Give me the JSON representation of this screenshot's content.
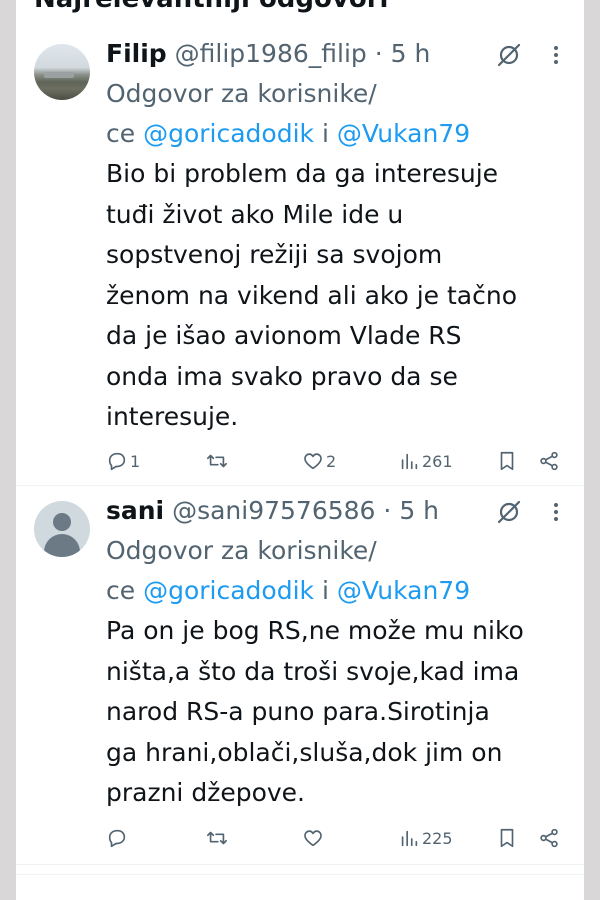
{
  "section": {
    "title": "Najrelevantniji odgovori"
  },
  "tweets": [
    {
      "name": "Filip",
      "handle": "@filip1986_filip",
      "dot": "·",
      "time": "5 h",
      "reply_prefix": "Odgovor za korisnike/",
      "reply_prefix2": "ce ",
      "mention1": "@goricadodik",
      "conj": " i ",
      "mention2": "@Vukan79",
      "body_lines": [
        "Bio bi problem da ga interesuje",
        "tuđi život ako Mile ide u",
        "sopstvenoj režiji sa svojom",
        "ženom na vikend ali ako je tačno",
        "da je išao avionom Vlade RS",
        "onda ima svako pravo da se",
        "interesuje."
      ],
      "replies": "1",
      "retweets": "",
      "likes": "2",
      "views": "261",
      "avatar_icon": "user-photo-avatar"
    },
    {
      "name": "sani",
      "handle": "@sani97576586",
      "dot": "·",
      "time": "5 h",
      "reply_prefix": "Odgovor za korisnike/",
      "reply_prefix2": "ce ",
      "mention1": "@goricadodik",
      "conj": " i ",
      "mention2": "@Vukan79",
      "body_lines": [
        "Pa on je bog RS,ne može mu niko",
        "ništa,a što da troši svoje,kad ima",
        "narod RS-a puno para.Sirotinja",
        "ga hrani,oblači,sluša,dok jim on",
        "prazni džepove."
      ],
      "replies": "",
      "retweets": "",
      "likes": "",
      "views": "225",
      "avatar_icon": "default-avatar"
    }
  ],
  "colors": {
    "text": "#0f1419",
    "secondary": "#536471",
    "link": "#1d9bf0",
    "background": "#ffffff",
    "outer": "#d9d7d8"
  }
}
